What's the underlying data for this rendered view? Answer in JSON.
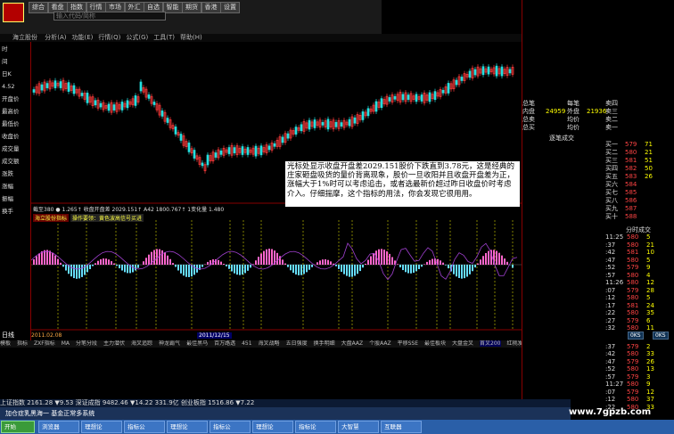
{
  "toolbar": {
    "buttons": [
      "综合",
      "看盘",
      "指数",
      "行情",
      "市场",
      "外汇",
      "自选",
      "智能",
      "期货",
      "香港",
      "设置"
    ],
    "search_placeholder": "输入代码/简称"
  },
  "menubar": {
    "stock_label": "海立股份",
    "items": [
      "分析(A)",
      "功能(E)",
      "行情(Q)",
      "公式(G)",
      "工具(T)",
      "帮助(H)"
    ]
  },
  "left_panel": {
    "items": [
      "时",
      "间",
      "日K",
      "4.52",
      "开盘价",
      "最高价",
      "最低价",
      "收盘价",
      "成交量",
      "成交额",
      "涨跌",
      "涨幅",
      "振幅",
      "换手"
    ]
  },
  "chart": {
    "header": "截至380 ● 1.265↑ 收盘开盘差 2029.151↑ A42 1800.767↑ 1变化量 1.480",
    "indicator_label": "海立股份指标",
    "indicator_note": "操作要领：黄色波高信号买进",
    "date_label": "2011/12/15",
    "period_label": "日线",
    "bottom_label": "2011.02.08"
  },
  "chart_data": {
    "type": "candlestick",
    "title": "",
    "indicator": "收盘开盘差",
    "values_shown": {
      "收盘开盘差": 2029.151,
      "A42": 1800.767
    }
  },
  "annotation": {
    "text": "光标处显示收盘开盘差2029.151股价下跌直到3.78元，这是经典的庄家砸盘吸货的量价背离现象，股价一旦收阳并且收盘开盘差为正，涨幅大于1%时可以考虑追击，或者选最新价超过昨日收盘价时考虑介入。仔细揣摩，这个指标的用法，你会发现它很用用。"
  },
  "tabs": [
    "模板",
    "指标",
    "ZXF指标",
    "MA",
    "分笔分段",
    "主力潜伏",
    "海叉追踪",
    "神龙霸气",
    "最佳黑马",
    "百万路透",
    "451",
    "海叉战略",
    "五日强度",
    "换手明细",
    "大盘AAZ",
    "个股AAZ",
    "平移SSE",
    "最佳板块",
    "大盘金叉",
    "首叉200",
    "红桃发射"
  ],
  "statusbar": {
    "text": "上证指数  2161.28  ▼9.53  深证成指  9482.46  ▼14.22  331.9亿 创业板指  1516.86  ▼7.22"
  },
  "ticker": {
    "text": "加仓症乳黑海一 基金正常多系统"
  },
  "taskbar": {
    "start": "开始",
    "tasks": [
      "浏览器",
      "理想论",
      "指标公",
      "理想论",
      "指标公",
      "理想论",
      "指标论",
      "大智慧",
      "互联器"
    ]
  },
  "right_panel": {
    "top": [
      {
        "label": "总笔",
        "value": "",
        "label2": "每笔",
        "value2": ""
      },
      {
        "label": "内盘",
        "value": "24959",
        "label2": "外盘",
        "value2": "21936"
      },
      {
        "label": "总卖",
        "value": "",
        "label2": "均价",
        "value2": ""
      },
      {
        "label": "总买",
        "value": "",
        "label2": "均价",
        "value2": ""
      }
    ],
    "sell": [
      "卖四",
      "卖三",
      "卖二",
      "卖一"
    ],
    "buy": [
      "买一",
      "买二",
      "买三",
      "买四",
      "买五",
      "买六",
      "买七",
      "买八",
      "买九",
      "买十"
    ],
    "buy_prices": [
      "579",
      "580",
      "581",
      "582",
      "583",
      "584",
      "585",
      "586",
      "587",
      "588"
    ],
    "buy_vols": [
      "71",
      "21",
      "51",
      "50",
      "26",
      "",
      "",
      "",
      "",
      ""
    ],
    "section_title": "逐笔成交",
    "section_title2": "分时成交",
    "trades": [
      {
        "time": "11:25",
        "price": "580",
        "vol": "5"
      },
      {
        "time": ":37",
        "price": "580",
        "vol": "21"
      },
      {
        "time": ":42",
        "price": "581",
        "vol": "10"
      },
      {
        "time": ":47",
        "price": "580",
        "vol": "5"
      },
      {
        "time": ":52",
        "price": "579",
        "vol": "9"
      },
      {
        "time": ":57",
        "price": "580",
        "vol": "4"
      },
      {
        "time": "11:26",
        "price": "580",
        "vol": "12"
      },
      {
        "time": ":07",
        "price": "579",
        "vol": "28"
      },
      {
        "time": ":12",
        "price": "580",
        "vol": "5"
      },
      {
        "time": ":17",
        "price": "581",
        "vol": "24"
      },
      {
        "time": ":22",
        "price": "580",
        "vol": "35"
      },
      {
        "time": ":27",
        "price": "579",
        "vol": "6"
      },
      {
        "time": ":32",
        "price": "580",
        "vol": "11"
      },
      {
        "time": ":37",
        "price": "579",
        "vol": "2"
      },
      {
        "time": ":42",
        "price": "580",
        "vol": "33"
      },
      {
        "time": ":47",
        "price": "579",
        "vol": "26"
      },
      {
        "time": ":52",
        "price": "580",
        "vol": "13"
      },
      {
        "time": ":57",
        "price": "579",
        "vol": "3"
      },
      {
        "time": "11:27",
        "price": "580",
        "vol": "9"
      },
      {
        "time": ":07",
        "price": "579",
        "vol": "12"
      },
      {
        "time": ":12",
        "price": "580",
        "vol": "37"
      },
      {
        "time": ":22",
        "price": "580",
        "vol": "33"
      }
    ],
    "mid_buttons": [
      "0KS",
      "0KS"
    ]
  },
  "watermark": "www.7gpzb.com"
}
